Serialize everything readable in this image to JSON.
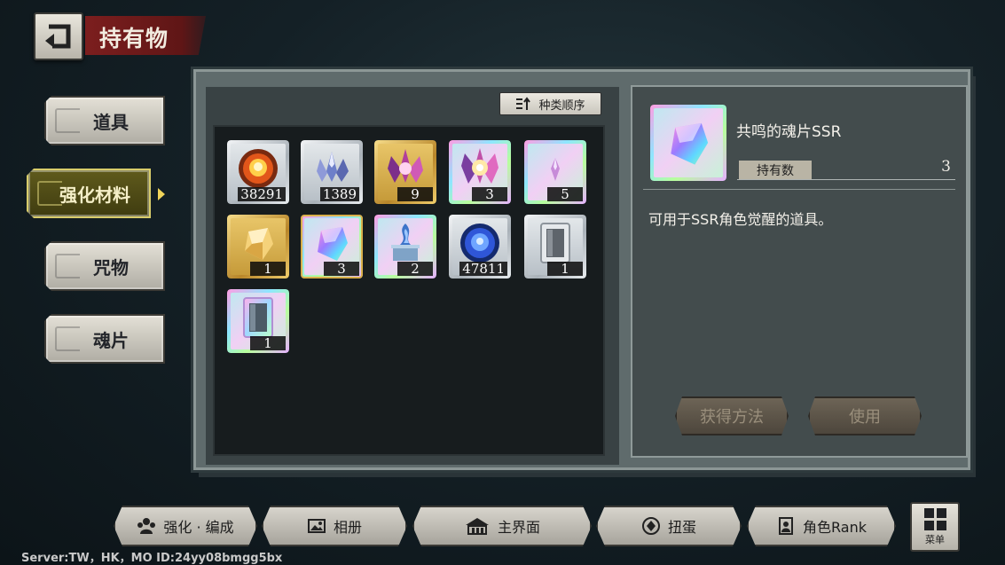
{
  "header": {
    "title": "持有物"
  },
  "categories": [
    {
      "label": "道具",
      "active": false
    },
    {
      "label": "强化材料",
      "active": true
    },
    {
      "label": "咒物",
      "active": false
    },
    {
      "label": "魂片",
      "active": false
    }
  ],
  "sort_button": {
    "label": "种类顺序"
  },
  "items": [
    {
      "name": "fire-orb",
      "count": "38291",
      "rarity": "silver"
    },
    {
      "name": "crystal-cluster",
      "count": "1389",
      "rarity": "silver"
    },
    {
      "name": "pink-crystal-cluster",
      "count": "9",
      "rarity": "gold"
    },
    {
      "name": "radiant-crystal-cluster",
      "count": "3",
      "rarity": "rainbow"
    },
    {
      "name": "small-crystal",
      "count": "5",
      "rarity": "rainbow"
    },
    {
      "name": "soul-fragment-sr",
      "count": "1",
      "rarity": "gold"
    },
    {
      "name": "soul-fragment-ssr",
      "count": "3",
      "rarity": "rainbow",
      "selected": true
    },
    {
      "name": "spirit-altar",
      "count": "2",
      "rarity": "rainbow"
    },
    {
      "name": "blue-orb",
      "count": "47811",
      "rarity": "silver"
    },
    {
      "name": "mirror-silver",
      "count": "1",
      "rarity": "silver"
    },
    {
      "name": "mirror-rainbow",
      "count": "1",
      "rarity": "rainbow"
    }
  ],
  "detail": {
    "name": "共鸣的魂片SSR",
    "held_label": "持有数",
    "held_value": "3",
    "description": "可用于SSR角色觉醒的道具。",
    "obtain_button": "获得方法",
    "use_button": "使用"
  },
  "bottom_nav": [
    {
      "label": "强化 · 编成",
      "icon": "team-icon"
    },
    {
      "label": "相册",
      "icon": "album-icon"
    },
    {
      "label": "主界面",
      "icon": "home-icon"
    },
    {
      "label": "扭蛋",
      "icon": "gacha-icon"
    },
    {
      "label": "角色Rank",
      "icon": "character-card-icon"
    }
  ],
  "menu_button": {
    "label": "菜单"
  },
  "server_info": "Server:TW，HK，MO ID:24yy08bmgg5bx",
  "colors": {
    "active_tab": "#4f4a16",
    "active_tab_border": "#d8cc6a",
    "title_banner": "#7c1e1e",
    "selection_border": "#d9b04a"
  }
}
